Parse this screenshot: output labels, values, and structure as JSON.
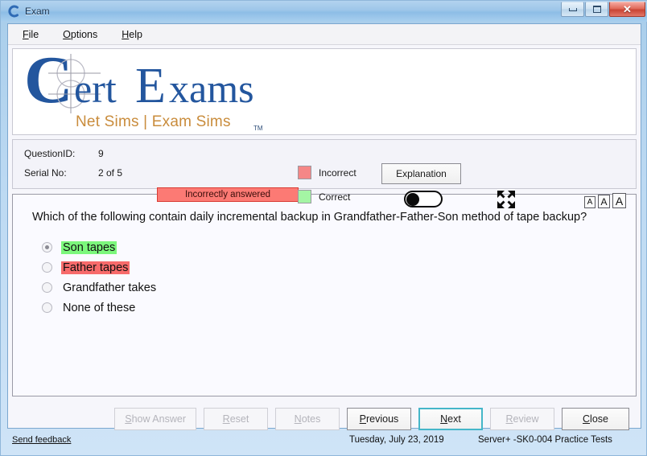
{
  "window": {
    "title": "Exam",
    "app_icon": "certexams-c-icon",
    "controls": {
      "minimize": "minimize-icon",
      "maximize": "maximize-icon",
      "close": "✕"
    }
  },
  "menubar": {
    "items": [
      {
        "label": "File",
        "mnemonic": "F"
      },
      {
        "label": "Options",
        "mnemonic": "O"
      },
      {
        "label": "Help",
        "mnemonic": "H"
      }
    ]
  },
  "logo": {
    "brand_part1": "C",
    "brand_part2": "ert",
    "brand_part3": "E",
    "brand_part4": "xams",
    "brand_full": "CertExams",
    "tagline_left": "Net Sims",
    "tagline_separator": "|",
    "tagline_right": "Exam Sims",
    "trademark": "TM",
    "brand_color": "#23569e",
    "tagline_color": "#c98c3c"
  },
  "info": {
    "question_id_label": "QuestionID:",
    "question_id_value": "9",
    "serial_label": "Serial No:",
    "serial_value": "2 of 5",
    "answered_badge": "Incorrectly answered",
    "answered_badge_bg": "#fc7a74",
    "legend": [
      {
        "label": "Incorrect",
        "color": "#f58787"
      },
      {
        "label": "Correct",
        "color": "#a4f5a4"
      }
    ],
    "explanation_button": "Explanation",
    "toggle_state": "off",
    "expand_icon": "expand-arrows-icon",
    "font_size_buttons": [
      {
        "label": "A",
        "name": "font-size-small"
      },
      {
        "label": "A",
        "name": "font-size-medium"
      },
      {
        "label": "A",
        "name": "font-size-large"
      }
    ]
  },
  "question": {
    "text": "Which of the following contain daily incremental backup in Grandfather-Father-Son method of tape backup?",
    "options": [
      {
        "label": "Son tapes",
        "selected": true,
        "highlight": "correct"
      },
      {
        "label": "Father tapes",
        "selected": false,
        "highlight": "incorrect"
      },
      {
        "label": "Grandfather takes",
        "selected": false,
        "highlight": "none"
      },
      {
        "label": "None of these",
        "selected": false,
        "highlight": "none"
      }
    ]
  },
  "buttons": [
    {
      "label": "Show Answer",
      "mnemonic": "S",
      "state": "disabled",
      "name": "show-answer-button"
    },
    {
      "label": "Reset",
      "mnemonic": "R",
      "state": "disabled",
      "name": "reset-button"
    },
    {
      "label": "Notes",
      "mnemonic": "N",
      "state": "disabled",
      "name": "notes-button"
    },
    {
      "label": "Previous",
      "mnemonic": "P",
      "state": "enabled",
      "name": "previous-button"
    },
    {
      "label": "Next",
      "mnemonic": "N",
      "state": "focused",
      "name": "next-button"
    },
    {
      "label": "Review",
      "mnemonic": "R",
      "state": "disabled",
      "name": "review-button"
    },
    {
      "label": "Close",
      "mnemonic": "C",
      "state": "enabled",
      "name": "close-button"
    }
  ],
  "statusbar": {
    "feedback_link": "Send feedback",
    "date": "Tuesday, July 23, 2019",
    "product": "Server+ -SK0-004 Practice Tests"
  }
}
